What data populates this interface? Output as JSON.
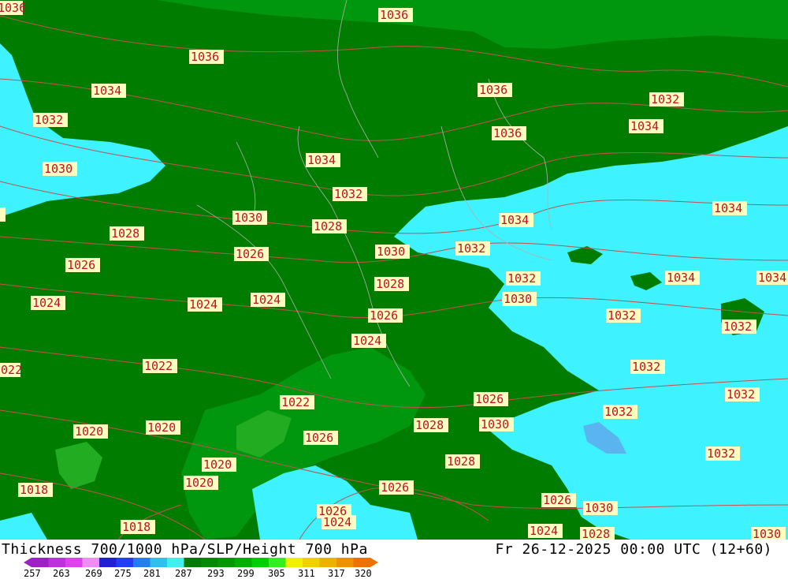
{
  "map": {
    "colors": {
      "sea_bright": "#3ef3ff",
      "land_dark": "#007d00",
      "land_medium": "#00960e",
      "land_light": "#22ac22",
      "contour": "#c25050",
      "contour_light": "#d08080",
      "border": "#b0b0b0"
    },
    "labels": [
      {
        "text": "1036"
      },
      {
        "text": "1036"
      },
      {
        "text": "1036"
      },
      {
        "text": "1036"
      },
      {
        "text": "1036"
      },
      {
        "text": "1034"
      },
      {
        "text": "1034"
      },
      {
        "text": "1034"
      },
      {
        "text": "1034"
      },
      {
        "text": "1034"
      },
      {
        "text": "1034"
      },
      {
        "text": "1034"
      },
      {
        "text": "1032"
      },
      {
        "text": "1032"
      },
      {
        "text": "1032"
      },
      {
        "text": "1032"
      },
      {
        "text": "1032"
      },
      {
        "text": "1032"
      },
      {
        "text": "1032"
      },
      {
        "text": "1032"
      },
      {
        "text": "1032"
      },
      {
        "text": "1032"
      },
      {
        "text": "1032"
      },
      {
        "text": "1030"
      },
      {
        "text": "1030"
      },
      {
        "text": "1030"
      },
      {
        "text": "1030"
      },
      {
        "text": "1030"
      },
      {
        "text": "1030"
      },
      {
        "text": "1030"
      },
      {
        "text": "1028"
      },
      {
        "text": "1028"
      },
      {
        "text": "1028"
      },
      {
        "text": "1028"
      },
      {
        "text": "1028"
      },
      {
        "text": "1028"
      },
      {
        "text": "1026"
      },
      {
        "text": "1026"
      },
      {
        "text": "1026"
      },
      {
        "text": "1026"
      },
      {
        "text": "1026"
      },
      {
        "text": "1026"
      },
      {
        "text": "1026"
      },
      {
        "text": "1026"
      },
      {
        "text": "1024"
      },
      {
        "text": "1024"
      },
      {
        "text": "1024"
      },
      {
        "text": "1024"
      },
      {
        "text": "1024"
      },
      {
        "text": "1024"
      },
      {
        "text": "1022"
      },
      {
        "text": "1022"
      },
      {
        "text": "1022"
      },
      {
        "text": "1020"
      },
      {
        "text": "1020"
      },
      {
        "text": "1020"
      },
      {
        "text": "1020"
      },
      {
        "text": "1018"
      },
      {
        "text": "1018"
      },
      {
        "text": "1034"
      },
      {
        "text": "1030"
      }
    ]
  },
  "footer": {
    "title": "Thickness 700/1000 hPa/SLP/Height 700 hPa",
    "timestamp": "Fr 26-12-2025 00:00 UTC (12+60)"
  },
  "legend": {
    "colors": [
      "#a020c8",
      "#c030e0",
      "#e040f0",
      "#f08cf8",
      "#2020d0",
      "#2040f0",
      "#2080f0",
      "#30c0f0",
      "#40f0f0",
      "#007d00",
      "#008a00",
      "#009a00",
      "#00b000",
      "#00d000",
      "#30f020",
      "#f0f000",
      "#f0d000",
      "#f0b000",
      "#f09000",
      "#f07000"
    ],
    "ticks": [
      "257",
      "263",
      "269",
      "275",
      "281",
      "287",
      "293",
      "299",
      "305",
      "311",
      "317",
      "320"
    ]
  }
}
